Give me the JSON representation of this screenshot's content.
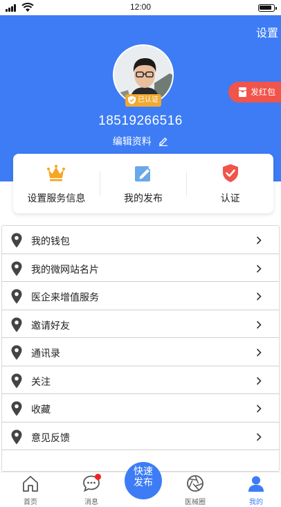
{
  "statusbar": {
    "time": "12:00"
  },
  "header": {
    "settings_label": "设置",
    "verified_label": "已认证",
    "red_packet_label": "发红包",
    "phone": "18519266516",
    "edit_label": "编辑资料"
  },
  "card": {
    "items": [
      {
        "label": "设置服务信息",
        "icon": "crown-icon"
      },
      {
        "label": "我的发布",
        "icon": "edit-icon"
      },
      {
        "label": "认证",
        "icon": "shield-check-icon"
      }
    ]
  },
  "menu": {
    "items": [
      {
        "label": "我的钱包"
      },
      {
        "label": "我的微网站名片"
      },
      {
        "label": "医企来增值服务"
      },
      {
        "label": "邀请好友"
      },
      {
        "label": "通讯录"
      },
      {
        "label": "关注"
      },
      {
        "label": "收藏"
      },
      {
        "label": "意见反馈"
      }
    ]
  },
  "nav": {
    "items": [
      {
        "label": "首页",
        "icon": "home-icon"
      },
      {
        "label": "消息",
        "icon": "message-icon"
      },
      {
        "label": "医械圈",
        "icon": "aperture-icon"
      },
      {
        "label": "我的",
        "icon": "user-icon"
      }
    ],
    "publish_label": "快速\n发布"
  },
  "colors": {
    "primary": "#3d7cf5",
    "badge": "#f0a932",
    "red": "#f0544b"
  }
}
